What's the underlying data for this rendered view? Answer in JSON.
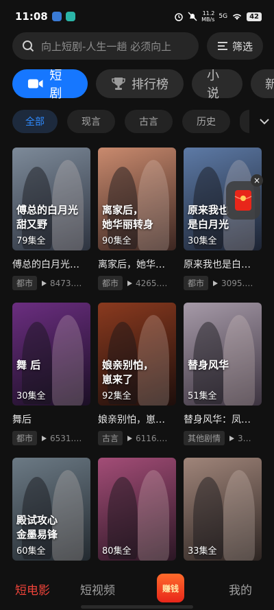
{
  "status_bar": {
    "time": "11:08",
    "net_speed_value": "11.2",
    "net_speed_unit": "MB/s",
    "network": "5G",
    "battery": "42"
  },
  "search": {
    "placeholder": "向上短剧-人生一趟 必须向上",
    "filter_label": "筛选"
  },
  "category_tabs": [
    {
      "label": "短剧",
      "icon": "video-camera-icon",
      "active": true
    },
    {
      "label": "排行榜",
      "icon": "trophy-icon",
      "active": false
    },
    {
      "label": "小说",
      "active": false
    },
    {
      "label": "新",
      "active": false
    }
  ],
  "genres": [
    "全部",
    "现言",
    "古言",
    "历史"
  ],
  "dramas": [
    {
      "title": "傅总的白月光…",
      "poster_text": "傅总的白月光\n甜又野",
      "episodes": "79集全",
      "tag": "都市",
      "views": "8473.…",
      "palette": [
        "#7d8a99",
        "#2e3440"
      ]
    },
    {
      "title": "离家后，她华…",
      "poster_text": "离家后，\n她华丽转身",
      "episodes": "90集全",
      "tag": "都市",
      "views": "4265.…",
      "palette": [
        "#c98a6e",
        "#3b2621"
      ]
    },
    {
      "title": "原来我也是白…",
      "poster_text": "原来我也\n是白月光",
      "episodes": "30集全",
      "tag": "都市",
      "views": "3095.…",
      "palette": [
        "#5d7aa6",
        "#1d2433"
      ]
    },
    {
      "title": "舞后",
      "poster_text": "舞  后",
      "episodes": "30集全",
      "tag": "都市",
      "views": "6531.…",
      "palette": [
        "#6b2e80",
        "#1b0f25"
      ]
    },
    {
      "title": "娘亲别怕，崽…",
      "poster_text": "娘亲别怕，\n崽来了",
      "episodes": "92集全",
      "tag": "古言",
      "views": "6116.…",
      "palette": [
        "#8a3a1f",
        "#1d0e0b"
      ]
    },
    {
      "title": "替身风华：凤…",
      "poster_text": "替身风华",
      "episodes": "51集全",
      "tag": "其他剧情",
      "views": "3…",
      "palette": [
        "#a69aa8",
        "#3d3440"
      ]
    },
    {
      "title": "",
      "poster_text": "殿试攻心\n金墨易锋",
      "episodes": "60集全",
      "tag": "",
      "views": "",
      "palette": [
        "#6c7a85",
        "#232a30"
      ]
    },
    {
      "title": "",
      "poster_text": "",
      "episodes": "80集全",
      "tag": "",
      "views": "",
      "palette": [
        "#a34d77",
        "#2b1624"
      ]
    },
    {
      "title": "",
      "poster_text": "",
      "episodes": "33集全",
      "tag": "",
      "views": "",
      "palette": [
        "#a0857a",
        "#2d2522"
      ]
    }
  ],
  "floating_ad": {
    "close": "×"
  },
  "bottom_nav": {
    "short_film": "短电影",
    "short_video": "短视频",
    "earn": "赚钱",
    "mine": "我的"
  },
  "colors": {
    "accent": "#1677ff",
    "nav_active": "#f0443a",
    "background": "#111111"
  }
}
